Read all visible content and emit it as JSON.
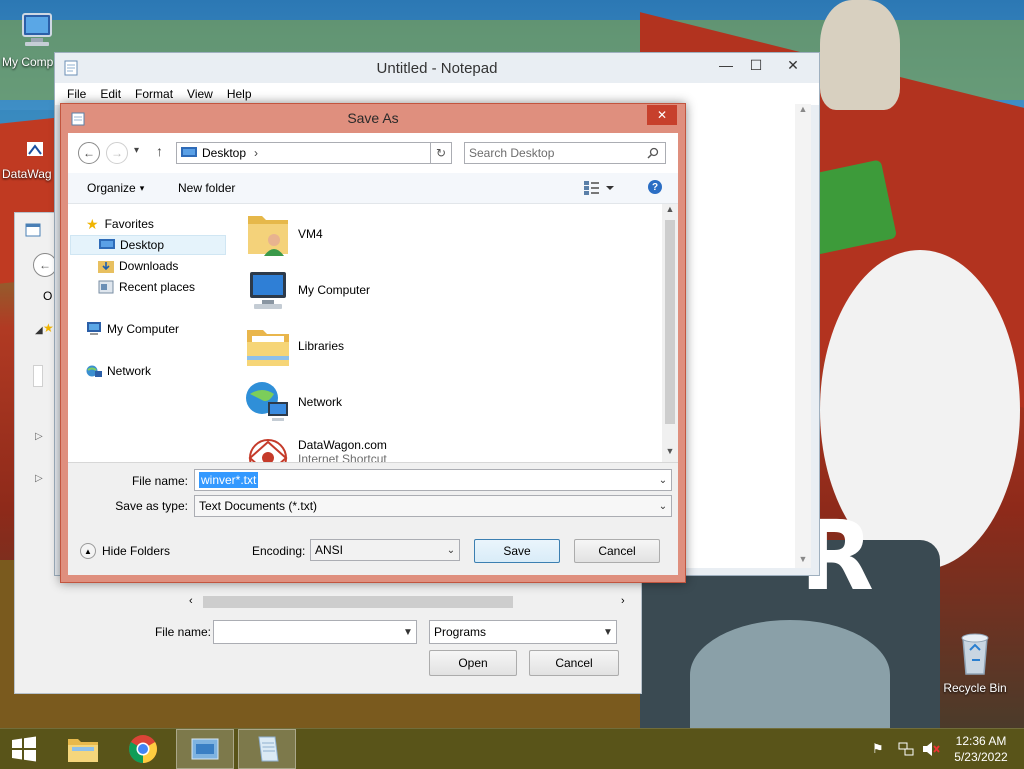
{
  "desktop": {
    "icons": [
      {
        "label": "My Comp",
        "icon": "my-computer-icon"
      },
      {
        "label": "DataWag",
        "icon": "datawagon-shortcut-icon"
      },
      {
        "label": "Recycle Bin",
        "icon": "recycle-bin-icon"
      }
    ]
  },
  "notepad": {
    "title": "Untitled - Notepad",
    "menu": [
      "File",
      "Edit",
      "Format",
      "View",
      "Help"
    ],
    "controls": {
      "minimize": "—",
      "maximize": "☐",
      "close": "✕"
    }
  },
  "open_dialog": {
    "file_name_label": "File name:",
    "file_name_value": "",
    "filter_value": "Programs",
    "open_label": "Open",
    "cancel_label": "Cancel",
    "partial_text": "O"
  },
  "saveas": {
    "title": "Save As",
    "close": "✕",
    "nav": {
      "back": "←",
      "forward": "→",
      "recent": "▾",
      "up": "↑",
      "location": "Desktop",
      "chevron": "›",
      "refresh": "↻",
      "search_placeholder": "Search Desktop"
    },
    "cmd": {
      "organize": "Organize",
      "organize_arrow": "▾",
      "new_folder": "New folder",
      "help": "?"
    },
    "tree": {
      "favorites": "Favorites",
      "desktop": "Desktop",
      "downloads": "Downloads",
      "recent": "Recent places",
      "my_computer": "My Computer",
      "network": "Network"
    },
    "files": [
      {
        "name": "VM4",
        "sub": "",
        "icon": "user-folder-icon"
      },
      {
        "name": "My Computer",
        "sub": "",
        "icon": "computer-icon"
      },
      {
        "name": "Libraries",
        "sub": "",
        "icon": "libraries-folder-icon"
      },
      {
        "name": "Network",
        "sub": "",
        "icon": "network-globe-icon"
      },
      {
        "name": "DataWagon.com",
        "sub": "Internet Shortcut",
        "icon": "datawagon-icon"
      }
    ],
    "file_name_label": "File name:",
    "file_name_value": "winver*.txt",
    "type_label": "Save as type:",
    "type_value": "Text Documents (*.txt)",
    "hide_folders": "Hide Folders",
    "encoding_label": "Encoding:",
    "encoding_value": "ANSI",
    "save_label": "Save",
    "cancel_label": "Cancel"
  },
  "taskbar": {
    "time": "12:36 AM",
    "date": "5/23/2022"
  },
  "colors": {
    "saveas_frame": "#df8f7e",
    "taskbar": "#585018",
    "selection": "#3399ff"
  }
}
